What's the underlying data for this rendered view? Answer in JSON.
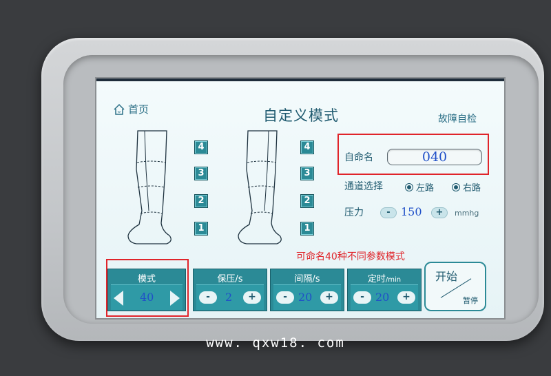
{
  "header": {
    "home_label": "首页",
    "title": "自定义模式",
    "diagnostics_label": "故障自检"
  },
  "legs": {
    "left_segments": [
      "4",
      "3",
      "2",
      "1"
    ],
    "right_segments": [
      "4",
      "3",
      "2",
      "1"
    ]
  },
  "settings": {
    "name_label": "自命名",
    "name_value": "040",
    "channel_label": "通道选择",
    "channel_left": "左路",
    "channel_right": "右路",
    "pressure_label": "压力",
    "pressure_minus": "-",
    "pressure_value": "150",
    "pressure_plus": "+",
    "pressure_unit": "mmhg"
  },
  "caption": "可命名40种不同参数模式",
  "controls": {
    "mode": {
      "label": "模式",
      "value": "40"
    },
    "hold": {
      "label": "保压/s",
      "minus": "-",
      "value": "2",
      "plus": "+"
    },
    "interval": {
      "label": "间隔/s",
      "minus": "-",
      "value": "20",
      "plus": "+"
    },
    "timer": {
      "label": "定时",
      "unit": "/min",
      "minus": "-",
      "value": "20",
      "plus": "+"
    }
  },
  "start_button": {
    "start_label": "开始",
    "pause_label": "暂停"
  },
  "watermark": "www. qxw18. com",
  "colors": {
    "accent": "#2b8a96",
    "highlight_box": "#e0242a",
    "value_text": "#2050c8"
  }
}
